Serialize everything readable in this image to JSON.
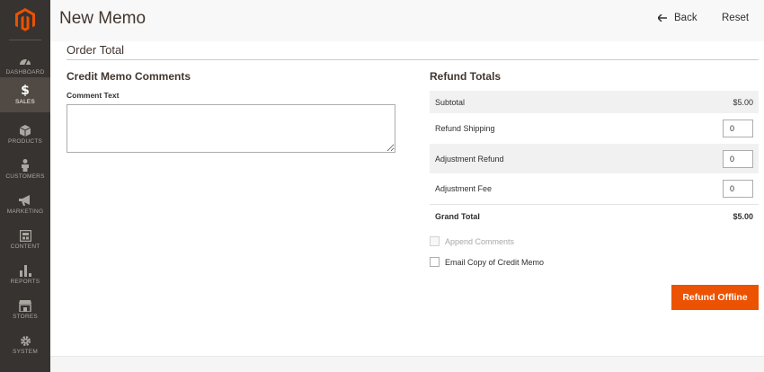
{
  "sidebar": {
    "items": [
      {
        "label": "DASHBOARD",
        "icon": "dashboard-icon"
      },
      {
        "label": "SALES",
        "icon": "dollar-icon"
      },
      {
        "label": "PRODUCTS",
        "icon": "cube-icon"
      },
      {
        "label": "CUSTOMERS",
        "icon": "person-icon"
      },
      {
        "label": "MARKETING",
        "icon": "megaphone-icon"
      },
      {
        "label": "CONTENT",
        "icon": "layout-icon"
      },
      {
        "label": "REPORTS",
        "icon": "bar-chart-icon"
      },
      {
        "label": "STORES",
        "icon": "storefront-icon"
      },
      {
        "label": "SYSTEM",
        "icon": "gear-icon"
      }
    ],
    "sales_symbol": "$"
  },
  "header": {
    "title": "New Memo",
    "back_label": "Back",
    "reset_label": "Reset"
  },
  "order_total": {
    "heading": "Order Total"
  },
  "comments": {
    "title": "Credit Memo Comments",
    "label": "Comment Text",
    "value": ""
  },
  "refund_totals": {
    "title": "Refund Totals",
    "subtotal_label": "Subtotal",
    "subtotal_value": "$5.00",
    "shipping_label": "Refund Shipping",
    "shipping_value": "0",
    "adj_refund_label": "Adjustment Refund",
    "adj_refund_value": "0",
    "adj_fee_label": "Adjustment Fee",
    "adj_fee_value": "0",
    "grand_label": "Grand Total",
    "grand_value": "$5.00"
  },
  "options": {
    "append_comments": "Append Comments",
    "email_copy": "Email Copy of Credit Memo"
  },
  "actions": {
    "refund_offline": "Refund Offline"
  },
  "colors": {
    "sidebar_bg": "#373330",
    "sidebar_active": "#514943",
    "accent": "#eb5202",
    "logo": "#eb5202"
  }
}
